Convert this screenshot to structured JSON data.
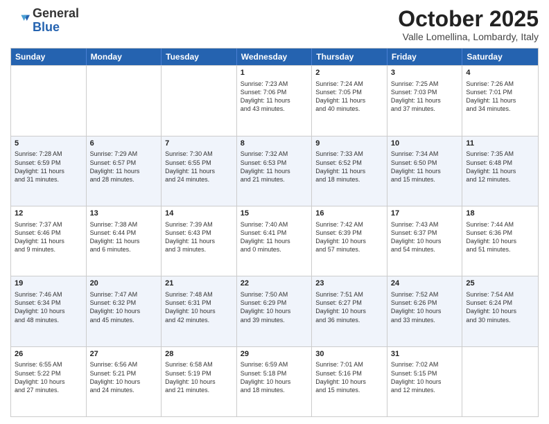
{
  "header": {
    "logo_line1": "General",
    "logo_line2": "Blue",
    "month_title": "October 2025",
    "location": "Valle Lomellina, Lombardy, Italy"
  },
  "days_of_week": [
    "Sunday",
    "Monday",
    "Tuesday",
    "Wednesday",
    "Thursday",
    "Friday",
    "Saturday"
  ],
  "rows": [
    [
      {
        "day": "",
        "lines": []
      },
      {
        "day": "",
        "lines": []
      },
      {
        "day": "",
        "lines": []
      },
      {
        "day": "1",
        "lines": [
          "Sunrise: 7:23 AM",
          "Sunset: 7:06 PM",
          "Daylight: 11 hours",
          "and 43 minutes."
        ]
      },
      {
        "day": "2",
        "lines": [
          "Sunrise: 7:24 AM",
          "Sunset: 7:05 PM",
          "Daylight: 11 hours",
          "and 40 minutes."
        ]
      },
      {
        "day": "3",
        "lines": [
          "Sunrise: 7:25 AM",
          "Sunset: 7:03 PM",
          "Daylight: 11 hours",
          "and 37 minutes."
        ]
      },
      {
        "day": "4",
        "lines": [
          "Sunrise: 7:26 AM",
          "Sunset: 7:01 PM",
          "Daylight: 11 hours",
          "and 34 minutes."
        ]
      }
    ],
    [
      {
        "day": "5",
        "lines": [
          "Sunrise: 7:28 AM",
          "Sunset: 6:59 PM",
          "Daylight: 11 hours",
          "and 31 minutes."
        ]
      },
      {
        "day": "6",
        "lines": [
          "Sunrise: 7:29 AM",
          "Sunset: 6:57 PM",
          "Daylight: 11 hours",
          "and 28 minutes."
        ]
      },
      {
        "day": "7",
        "lines": [
          "Sunrise: 7:30 AM",
          "Sunset: 6:55 PM",
          "Daylight: 11 hours",
          "and 24 minutes."
        ]
      },
      {
        "day": "8",
        "lines": [
          "Sunrise: 7:32 AM",
          "Sunset: 6:53 PM",
          "Daylight: 11 hours",
          "and 21 minutes."
        ]
      },
      {
        "day": "9",
        "lines": [
          "Sunrise: 7:33 AM",
          "Sunset: 6:52 PM",
          "Daylight: 11 hours",
          "and 18 minutes."
        ]
      },
      {
        "day": "10",
        "lines": [
          "Sunrise: 7:34 AM",
          "Sunset: 6:50 PM",
          "Daylight: 11 hours",
          "and 15 minutes."
        ]
      },
      {
        "day": "11",
        "lines": [
          "Sunrise: 7:35 AM",
          "Sunset: 6:48 PM",
          "Daylight: 11 hours",
          "and 12 minutes."
        ]
      }
    ],
    [
      {
        "day": "12",
        "lines": [
          "Sunrise: 7:37 AM",
          "Sunset: 6:46 PM",
          "Daylight: 11 hours",
          "and 9 minutes."
        ]
      },
      {
        "day": "13",
        "lines": [
          "Sunrise: 7:38 AM",
          "Sunset: 6:44 PM",
          "Daylight: 11 hours",
          "and 6 minutes."
        ]
      },
      {
        "day": "14",
        "lines": [
          "Sunrise: 7:39 AM",
          "Sunset: 6:43 PM",
          "Daylight: 11 hours",
          "and 3 minutes."
        ]
      },
      {
        "day": "15",
        "lines": [
          "Sunrise: 7:40 AM",
          "Sunset: 6:41 PM",
          "Daylight: 11 hours",
          "and 0 minutes."
        ]
      },
      {
        "day": "16",
        "lines": [
          "Sunrise: 7:42 AM",
          "Sunset: 6:39 PM",
          "Daylight: 10 hours",
          "and 57 minutes."
        ]
      },
      {
        "day": "17",
        "lines": [
          "Sunrise: 7:43 AM",
          "Sunset: 6:37 PM",
          "Daylight: 10 hours",
          "and 54 minutes."
        ]
      },
      {
        "day": "18",
        "lines": [
          "Sunrise: 7:44 AM",
          "Sunset: 6:36 PM",
          "Daylight: 10 hours",
          "and 51 minutes."
        ]
      }
    ],
    [
      {
        "day": "19",
        "lines": [
          "Sunrise: 7:46 AM",
          "Sunset: 6:34 PM",
          "Daylight: 10 hours",
          "and 48 minutes."
        ]
      },
      {
        "day": "20",
        "lines": [
          "Sunrise: 7:47 AM",
          "Sunset: 6:32 PM",
          "Daylight: 10 hours",
          "and 45 minutes."
        ]
      },
      {
        "day": "21",
        "lines": [
          "Sunrise: 7:48 AM",
          "Sunset: 6:31 PM",
          "Daylight: 10 hours",
          "and 42 minutes."
        ]
      },
      {
        "day": "22",
        "lines": [
          "Sunrise: 7:50 AM",
          "Sunset: 6:29 PM",
          "Daylight: 10 hours",
          "and 39 minutes."
        ]
      },
      {
        "day": "23",
        "lines": [
          "Sunrise: 7:51 AM",
          "Sunset: 6:27 PM",
          "Daylight: 10 hours",
          "and 36 minutes."
        ]
      },
      {
        "day": "24",
        "lines": [
          "Sunrise: 7:52 AM",
          "Sunset: 6:26 PM",
          "Daylight: 10 hours",
          "and 33 minutes."
        ]
      },
      {
        "day": "25",
        "lines": [
          "Sunrise: 7:54 AM",
          "Sunset: 6:24 PM",
          "Daylight: 10 hours",
          "and 30 minutes."
        ]
      }
    ],
    [
      {
        "day": "26",
        "lines": [
          "Sunrise: 6:55 AM",
          "Sunset: 5:22 PM",
          "Daylight: 10 hours",
          "and 27 minutes."
        ]
      },
      {
        "day": "27",
        "lines": [
          "Sunrise: 6:56 AM",
          "Sunset: 5:21 PM",
          "Daylight: 10 hours",
          "and 24 minutes."
        ]
      },
      {
        "day": "28",
        "lines": [
          "Sunrise: 6:58 AM",
          "Sunset: 5:19 PM",
          "Daylight: 10 hours",
          "and 21 minutes."
        ]
      },
      {
        "day": "29",
        "lines": [
          "Sunrise: 6:59 AM",
          "Sunset: 5:18 PM",
          "Daylight: 10 hours",
          "and 18 minutes."
        ]
      },
      {
        "day": "30",
        "lines": [
          "Sunrise: 7:01 AM",
          "Sunset: 5:16 PM",
          "Daylight: 10 hours",
          "and 15 minutes."
        ]
      },
      {
        "day": "31",
        "lines": [
          "Sunrise: 7:02 AM",
          "Sunset: 5:15 PM",
          "Daylight: 10 hours",
          "and 12 minutes."
        ]
      },
      {
        "day": "",
        "lines": []
      }
    ]
  ]
}
